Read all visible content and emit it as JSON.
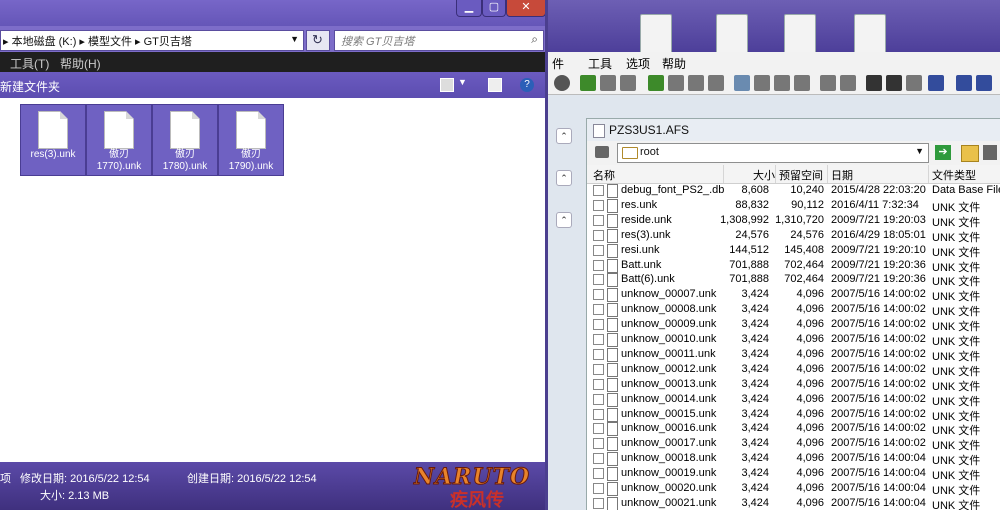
{
  "explorer": {
    "address": "▸ 本地磁盘 (K:) ▸ 模型文件 ▸ GT贝吉塔",
    "search_placeholder": "搜索 GT贝吉塔",
    "menu": [
      "工具(T)",
      "帮助(H)"
    ],
    "new_folder_label": "新建文件夹",
    "files": [
      {
        "label": "res(3).unk"
      },
      {
        "label": "傲刃\n1770).unk"
      },
      {
        "label": "傲刃\n1780).unk"
      },
      {
        "label": "傲刃\n1790).unk"
      }
    ],
    "status": {
      "items_prefix": "项",
      "modified_label": "修改日期: 2016/5/22 12:54",
      "created_label": "创建日期: 2016/5/22 12:54",
      "size_label": "大小: 2.13 MB"
    },
    "logo_text": "NARUTO",
    "logo_sub": "疾风传"
  },
  "afs": {
    "menu": [
      "件",
      "工具",
      "选项",
      "帮助"
    ],
    "window_title": "PZS3US1.AFS",
    "path": "root",
    "columns": [
      "名称",
      "大小",
      "预留空间",
      "日期",
      "文件类型"
    ],
    "rows": [
      {
        "name": "debug_font_PS2_.db",
        "size": "8,608",
        "space": "10,240",
        "date": "2015/4/28 22:03:20",
        "type": "Data Base File"
      },
      {
        "name": "res.unk",
        "size": "88,832",
        "space": "90,112",
        "date": "2016/4/11 7:32:34",
        "type": "UNK 文件"
      },
      {
        "name": "reside.unk",
        "size": "1,308,992",
        "space": "1,310,720",
        "date": "2009/7/21 19:20:03",
        "type": "UNK 文件"
      },
      {
        "name": "res(3).unk",
        "size": "24,576",
        "space": "24,576",
        "date": "2016/4/29 18:05:01",
        "type": "UNK 文件"
      },
      {
        "name": "resi.unk",
        "size": "144,512",
        "space": "145,408",
        "date": "2009/7/21 19:20:10",
        "type": "UNK 文件"
      },
      {
        "name": "Batt.unk",
        "size": "701,888",
        "space": "702,464",
        "date": "2009/7/21 19:20:36",
        "type": "UNK 文件"
      },
      {
        "name": "Batt(6).unk",
        "size": "701,888",
        "space": "702,464",
        "date": "2009/7/21 19:20:36",
        "type": "UNK 文件"
      },
      {
        "name": "unknow_00007.unk",
        "size": "3,424",
        "space": "4,096",
        "date": "2007/5/16 14:00:02",
        "type": "UNK 文件"
      },
      {
        "name": "unknow_00008.unk",
        "size": "3,424",
        "space": "4,096",
        "date": "2007/5/16 14:00:02",
        "type": "UNK 文件"
      },
      {
        "name": "unknow_00009.unk",
        "size": "3,424",
        "space": "4,096",
        "date": "2007/5/16 14:00:02",
        "type": "UNK 文件"
      },
      {
        "name": "unknow_00010.unk",
        "size": "3,424",
        "space": "4,096",
        "date": "2007/5/16 14:00:02",
        "type": "UNK 文件"
      },
      {
        "name": "unknow_00011.unk",
        "size": "3,424",
        "space": "4,096",
        "date": "2007/5/16 14:00:02",
        "type": "UNK 文件"
      },
      {
        "name": "unknow_00012.unk",
        "size": "3,424",
        "space": "4,096",
        "date": "2007/5/16 14:00:02",
        "type": "UNK 文件"
      },
      {
        "name": "unknow_00013.unk",
        "size": "3,424",
        "space": "4,096",
        "date": "2007/5/16 14:00:02",
        "type": "UNK 文件"
      },
      {
        "name": "unknow_00014.unk",
        "size": "3,424",
        "space": "4,096",
        "date": "2007/5/16 14:00:02",
        "type": "UNK 文件"
      },
      {
        "name": "unknow_00015.unk",
        "size": "3,424",
        "space": "4,096",
        "date": "2007/5/16 14:00:02",
        "type": "UNK 文件"
      },
      {
        "name": "unknow_00016.unk",
        "size": "3,424",
        "space": "4,096",
        "date": "2007/5/16 14:00:02",
        "type": "UNK 文件"
      },
      {
        "name": "unknow_00017.unk",
        "size": "3,424",
        "space": "4,096",
        "date": "2007/5/16 14:00:02",
        "type": "UNK 文件"
      },
      {
        "name": "unknow_00018.unk",
        "size": "3,424",
        "space": "4,096",
        "date": "2007/5/16 14:00:04",
        "type": "UNK 文件"
      },
      {
        "name": "unknow_00019.unk",
        "size": "3,424",
        "space": "4,096",
        "date": "2007/5/16 14:00:04",
        "type": "UNK 文件"
      },
      {
        "name": "unknow_00020.unk",
        "size": "3,424",
        "space": "4,096",
        "date": "2007/5/16 14:00:04",
        "type": "UNK 文件"
      },
      {
        "name": "unknow_00021.unk",
        "size": "3,424",
        "space": "4,096",
        "date": "2007/5/16 14:00:04",
        "type": "UNK 文件"
      }
    ]
  }
}
